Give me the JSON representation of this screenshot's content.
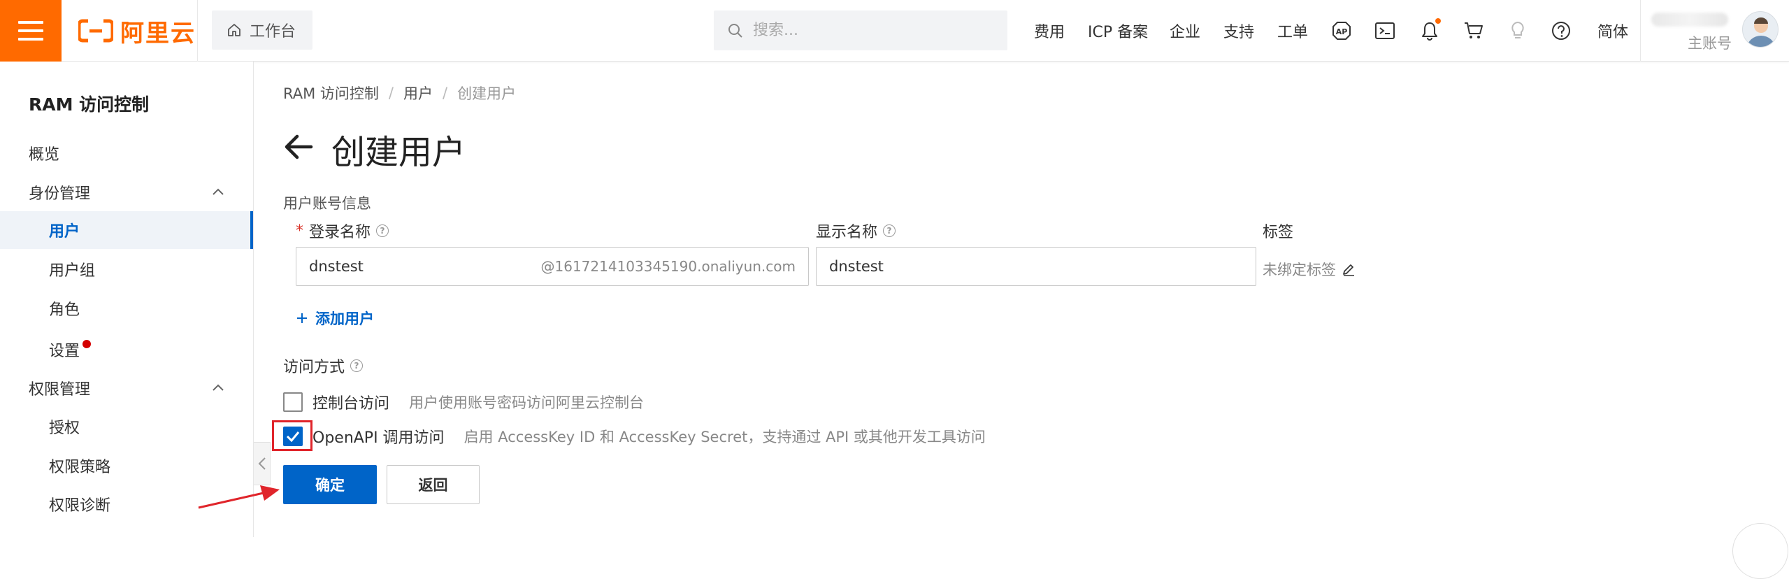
{
  "topbar": {
    "logo_text": "阿里云",
    "workbench_label": "工作台",
    "search_placeholder": "搜索...",
    "nav_links": [
      "费用",
      "ICP 备案",
      "企业",
      "支持",
      "工单"
    ],
    "icons": [
      "app-icon",
      "terminal-icon",
      "bell-icon",
      "cart-icon",
      "lightbulb-icon",
      "help-icon"
    ],
    "language": "简体",
    "account_label": "主账号",
    "brand_color": "#ff6a00"
  },
  "sidebar": {
    "title": "RAM 访问控制",
    "items": [
      {
        "label": "概览",
        "level": 1
      },
      {
        "label": "身份管理",
        "level": 1,
        "expanded": true
      },
      {
        "label": "用户",
        "level": 2,
        "active": true
      },
      {
        "label": "用户组",
        "level": 2
      },
      {
        "label": "角色",
        "level": 2
      },
      {
        "label": "设置",
        "level": 2,
        "badge": "red-dot"
      },
      {
        "label": "权限管理",
        "level": 1,
        "expanded": true
      },
      {
        "label": "授权",
        "level": 2
      },
      {
        "label": "权限策略",
        "level": 2
      },
      {
        "label": "权限诊断",
        "level": 2
      }
    ]
  },
  "breadcrumb": [
    "RAM 访问控制",
    "用户",
    "创建用户"
  ],
  "page_title": "创建用户",
  "form": {
    "section_label": "用户账号信息",
    "login_name_label": "登录名称",
    "login_name_value": "dnstest",
    "login_name_suffix": "@1617214103345190.onaliyun.com",
    "display_name_label": "显示名称",
    "display_name_value": "dnstest",
    "tags_label": "标签",
    "tags_value": "未绑定标签",
    "add_user_label": "添加用户",
    "access_label": "访问方式",
    "access_options": [
      {
        "label": "控制台访问",
        "desc": "用户使用账号密码访问阿里云控制台",
        "checked": false
      },
      {
        "label": "OpenAPI 调用访问",
        "desc": "启用 AccessKey ID 和 AccessKey Secret，支持通过 API 或其他开发工具访问",
        "checked": true
      }
    ],
    "confirm_label": "确定",
    "back_label": "返回"
  },
  "colors": {
    "primary": "#0064c8",
    "annotation_red": "#e0252b"
  }
}
